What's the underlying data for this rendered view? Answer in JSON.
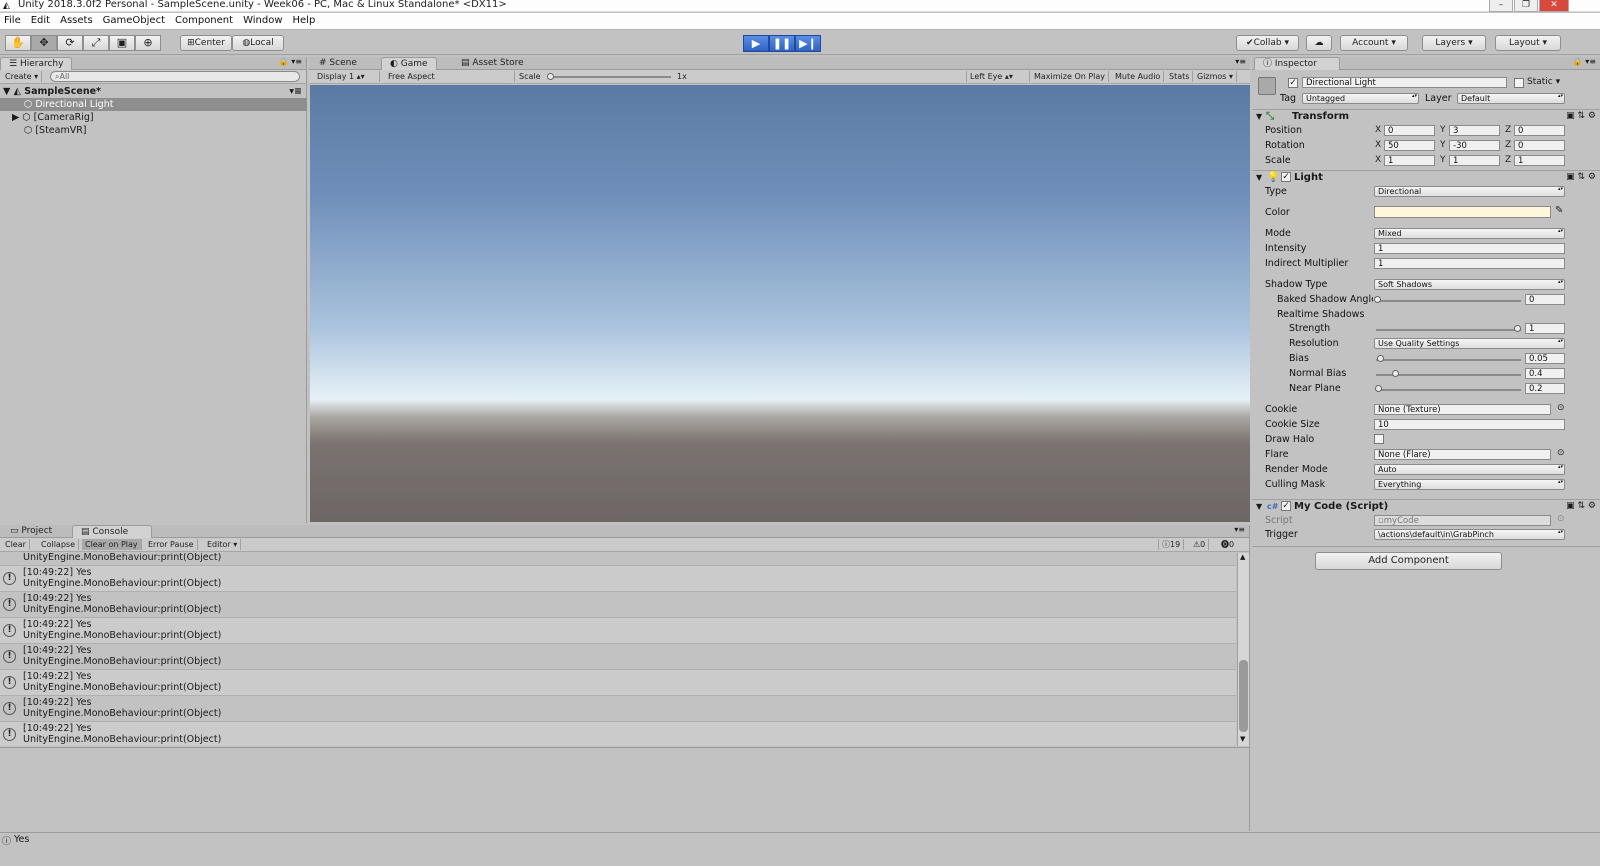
{
  "window": {
    "title": "Unity 2018.3.0f2 Personal - SampleScene.unity - Week06 - PC, Mac & Linux Standalone* <DX11>"
  },
  "menu": [
    "File",
    "Edit",
    "Assets",
    "GameObject",
    "Component",
    "Window",
    "Help"
  ],
  "toolbar": {
    "center": "Center",
    "local": "Local",
    "collab": "Collab",
    "account": "Account",
    "layers": "Layers",
    "layout": "Layout"
  },
  "hierarchy": {
    "tab": "Hierarchy",
    "create": "Create",
    "search_placeholder": "All",
    "scene": "SampleScene*",
    "items": [
      "Directional Light",
      "[CameraRig]",
      "[SteamVR]"
    ]
  },
  "game": {
    "tabs": [
      "Scene",
      "Game",
      "Asset Store"
    ],
    "display": "Display 1",
    "aspect": "Free Aspect",
    "scale_label": "Scale",
    "scale_value": "1x",
    "eye": "Left Eye",
    "maximize": "Maximize On Play",
    "mute": "Mute Audio",
    "stats": "Stats",
    "gizmos": "Gizmos"
  },
  "console": {
    "tabs": [
      "Project",
      "Console"
    ],
    "buttons": [
      "Clear",
      "Collapse",
      "Clear on Play",
      "Error Pause",
      "Editor"
    ],
    "counts": {
      "info": "19",
      "warn": "0",
      "error": "0"
    },
    "partial_line": "UnityEngine.MonoBehaviour:print(Object)",
    "entries": [
      {
        "line1": "[10:49:22] Yes",
        "line2": "UnityEngine.MonoBehaviour:print(Object)"
      },
      {
        "line1": "[10:49:22] Yes",
        "line2": "UnityEngine.MonoBehaviour:print(Object)"
      },
      {
        "line1": "[10:49:22] Yes",
        "line2": "UnityEngine.MonoBehaviour:print(Object)"
      },
      {
        "line1": "[10:49:22] Yes",
        "line2": "UnityEngine.MonoBehaviour:print(Object)"
      },
      {
        "line1": "[10:49:22] Yes",
        "line2": "UnityEngine.MonoBehaviour:print(Object)"
      },
      {
        "line1": "[10:49:22] Yes",
        "line2": "UnityEngine.MonoBehaviour:print(Object)"
      },
      {
        "line1": "[10:49:22] Yes",
        "line2": "UnityEngine.MonoBehaviour:print(Object)"
      }
    ]
  },
  "status": {
    "text": "Yes"
  },
  "inspector": {
    "tab": "Inspector",
    "object_name": "Directional Light",
    "static": "Static",
    "tag_label": "Tag",
    "tag": "Untagged",
    "layer_label": "Layer",
    "layer": "Default",
    "transform": {
      "title": "Transform",
      "position": {
        "label": "Position",
        "x": "0",
        "y": "3",
        "z": "0"
      },
      "rotation": {
        "label": "Rotation",
        "x": "50",
        "y": "-30",
        "z": "0"
      },
      "scale": {
        "label": "Scale",
        "x": "1",
        "y": "1",
        "z": "1"
      }
    },
    "light": {
      "title": "Light",
      "type_label": "Type",
      "type": "Directional",
      "color_label": "Color",
      "mode_label": "Mode",
      "mode": "Mixed",
      "intensity_label": "Intensity",
      "intensity": "1",
      "indirect_label": "Indirect Multiplier",
      "indirect": "1",
      "shadow_type_label": "Shadow Type",
      "shadow_type": "Soft Shadows",
      "baked_angle_label": "Baked Shadow Angle",
      "baked_angle": "0",
      "realtime_label": "Realtime Shadows",
      "strength_label": "Strength",
      "strength": "1",
      "resolution_label": "Resolution",
      "resolution": "Use Quality Settings",
      "bias_label": "Bias",
      "bias": "0.05",
      "normal_bias_label": "Normal Bias",
      "normal_bias": "0.4",
      "near_plane_label": "Near Plane",
      "near_plane": "0.2",
      "cookie_label": "Cookie",
      "cookie": "None (Texture)",
      "cookie_size_label": "Cookie Size",
      "cookie_size": "10",
      "draw_halo_label": "Draw Halo",
      "flare_label": "Flare",
      "flare": "None (Flare)",
      "render_mode_label": "Render Mode",
      "render_mode": "Auto",
      "culling_label": "Culling Mask",
      "culling": "Everything"
    },
    "script": {
      "title": "My Code (Script)",
      "script_label": "Script",
      "script": "myCode",
      "trigger_label": "Trigger",
      "trigger": "\\actions\\default\\in\\GrabPinch"
    },
    "add_component": "Add Component"
  },
  "colors": {
    "accent": "#2d62c4",
    "light_color": "#fff6dc"
  }
}
